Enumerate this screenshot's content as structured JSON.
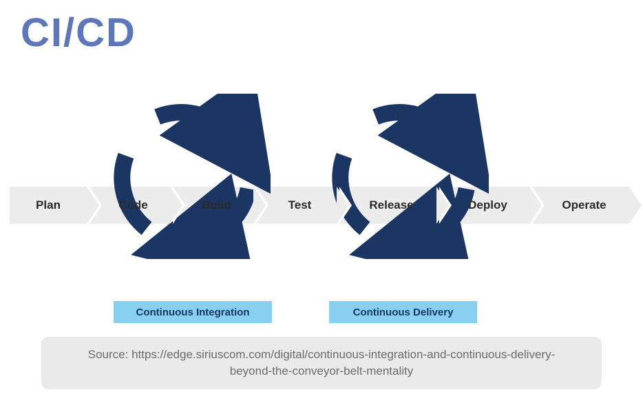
{
  "title": "CI/CD",
  "pipeline": {
    "steps": [
      "Plan",
      "Code",
      "Build",
      "Test",
      "Release",
      "Deploy",
      "Operate"
    ]
  },
  "loops": {
    "ci": {
      "label": "Continuous Integration",
      "spans": [
        "Code",
        "Build",
        "Test"
      ]
    },
    "cd": {
      "label": "Continuous Delivery",
      "spans": [
        "Release",
        "Deploy"
      ]
    }
  },
  "source": {
    "prefix": "Source: ",
    "url": "https://edge.siriuscom.com/digital/continuous-integration-and-continuous-delivery-beyond-the-conveyor-belt-mentality"
  },
  "colors": {
    "title": "#5d77b9",
    "arrow_dark": "#1c3663",
    "badge_bg": "#88d0f2",
    "badge_text": "#15365e",
    "step_bg": "#ececec",
    "step_text": "#2a2a2a",
    "source_bg": "#eaeaea",
    "source_text": "#6b6b6b"
  }
}
